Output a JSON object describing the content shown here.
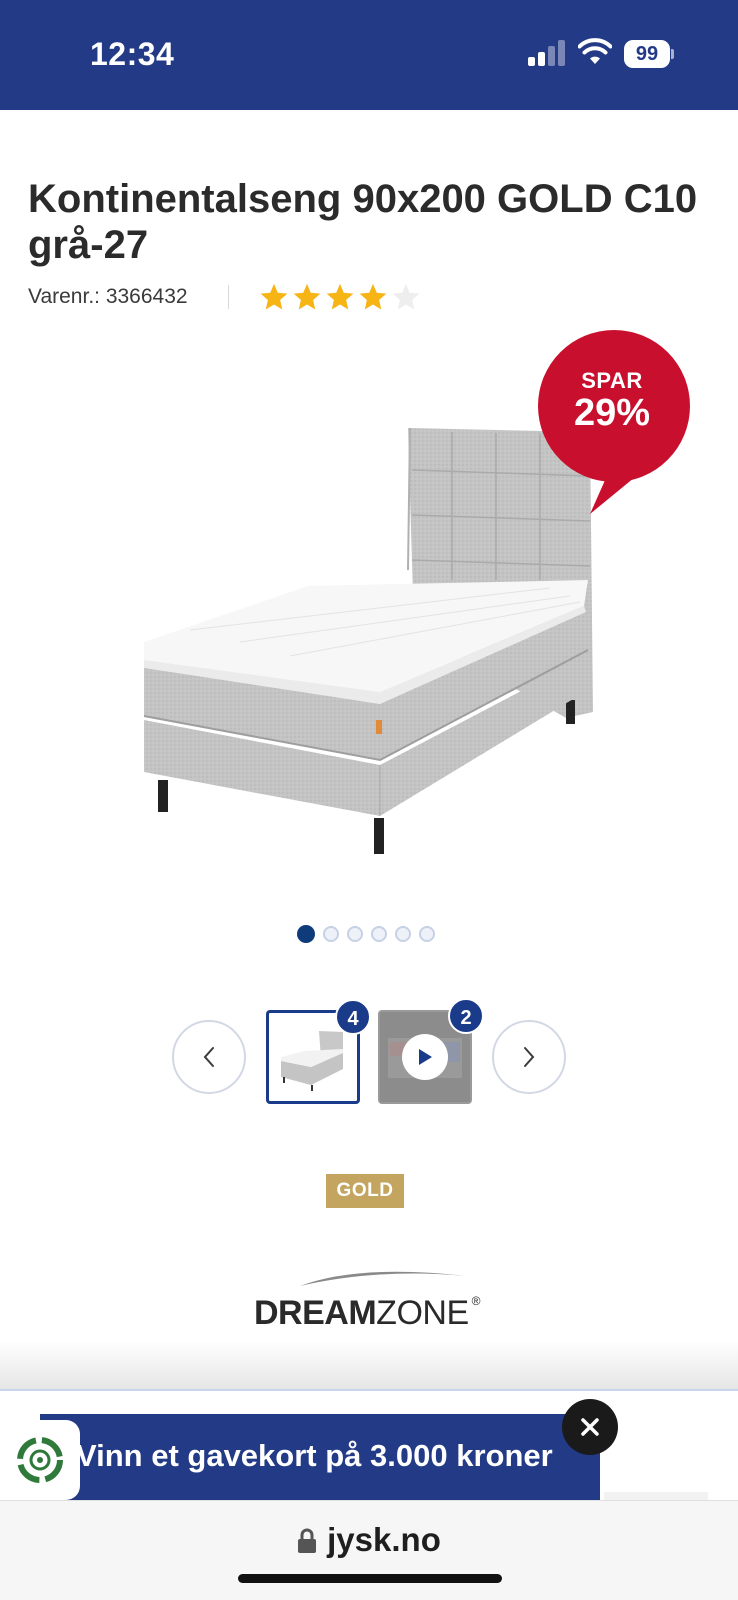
{
  "status_bar": {
    "time": "12:34",
    "battery": "99",
    "signal_icon": "cellular-signal-icon",
    "wifi_icon": "wifi-icon",
    "color": "#233a87"
  },
  "product": {
    "title": "Kontinentalseng 90x200 GOLD C10 grå-27",
    "sku": "Varenr.: 3366432",
    "rating": 4,
    "rating_max": 5
  },
  "badge": {
    "line1": "SPAR",
    "line2": "29%",
    "color": "#c8102e"
  },
  "gallery": {
    "dot_count": 6,
    "active_dot": 1,
    "image_count": "4",
    "video_count": "2",
    "prev_icon": "chevron-left-icon",
    "next_icon": "chevron-right-icon"
  },
  "labels": {
    "gold": "GOLD",
    "brand_bold": "DREAM",
    "brand_light": "ZONE",
    "brand_reg": "®"
  },
  "promo": {
    "text": "Vinn et gavekort på 3.000 kroner",
    "close_icon": "close-icon",
    "side_icon": "recycle-icon"
  },
  "browser": {
    "url": "jysk.no",
    "lock_icon": "lock-icon"
  },
  "colors": {
    "brand_blue": "#233a87",
    "star": "#f6b514",
    "gold": "#c3a55f"
  }
}
